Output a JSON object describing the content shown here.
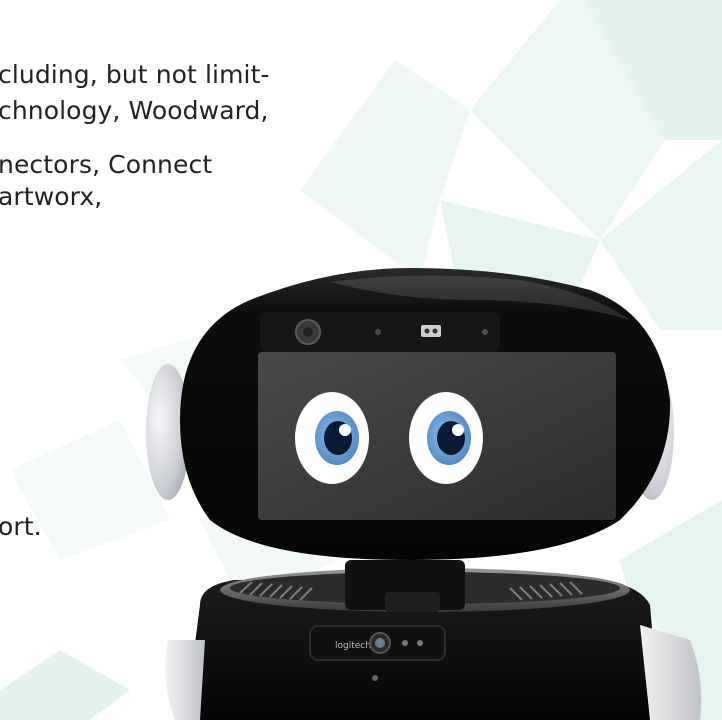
{
  "text_lines": [
    "cluding, but not limit-",
    "chnology, Woodward,",
    "nectors, Connect",
    "artworx,",
    "ort."
  ],
  "camera": {
    "brand": "logitech"
  },
  "colors": {
    "background": "#ffffff",
    "pattern_mint": "#e8f5f1",
    "pattern_mint_light": "#f1f9f6",
    "text": "#222222",
    "robot_shell": "#0c0c0c",
    "screen": "#3a3a3a",
    "eye_iris": "#6fa3d8",
    "eye_white": "#ffffff"
  }
}
